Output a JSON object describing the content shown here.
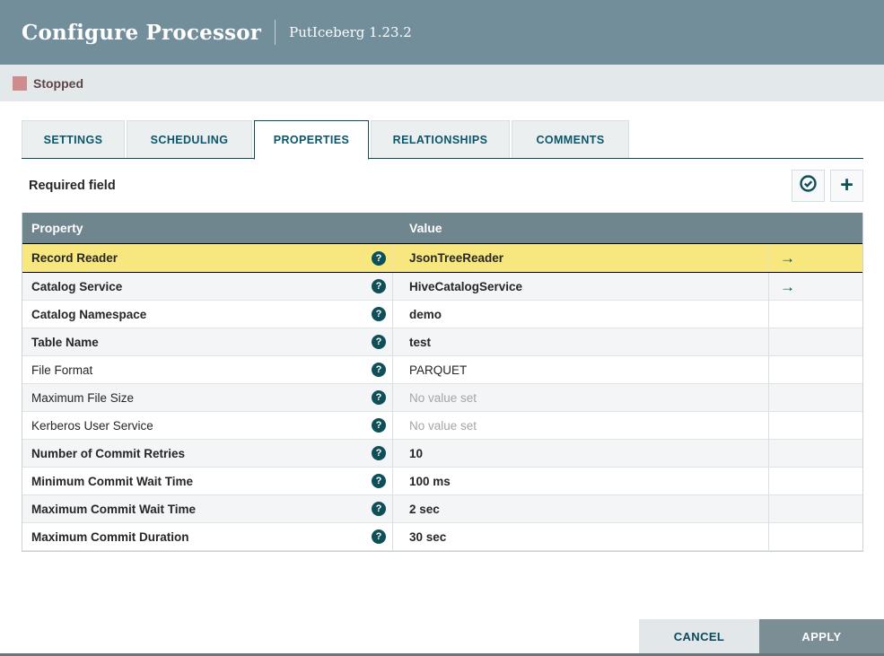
{
  "dialog": {
    "title": "Configure Processor",
    "subtitle": "PutIceberg 1.23.2"
  },
  "status": {
    "label": "Stopped",
    "color": "#CF8C8C"
  },
  "tabs": [
    {
      "label": "SETTINGS",
      "active": false
    },
    {
      "label": "SCHEDULING",
      "active": false
    },
    {
      "label": "PROPERTIES",
      "active": true
    },
    {
      "label": "RELATIONSHIPS",
      "active": false
    },
    {
      "label": "COMMENTS",
      "active": false
    }
  ],
  "properties_panel": {
    "required_field_label": "Required field",
    "verify_icon": "circle-check-icon",
    "add_icon": "plus-icon",
    "plus_glyph": "+"
  },
  "table": {
    "columns": [
      "Property",
      "Value"
    ],
    "help_glyph": "?",
    "goto_glyph": "→",
    "rows": [
      {
        "property": "Record Reader",
        "value": "JsonTreeReader",
        "required": true,
        "empty": false,
        "controller_link": true,
        "selected": true
      },
      {
        "property": "Catalog Service",
        "value": "HiveCatalogService",
        "required": true,
        "empty": false,
        "controller_link": true,
        "selected": false
      },
      {
        "property": "Catalog Namespace",
        "value": "demo",
        "required": true,
        "empty": false,
        "controller_link": false,
        "selected": false
      },
      {
        "property": "Table Name",
        "value": "test",
        "required": true,
        "empty": false,
        "controller_link": false,
        "selected": false
      },
      {
        "property": "File Format",
        "value": "PARQUET",
        "required": false,
        "empty": false,
        "controller_link": false,
        "selected": false
      },
      {
        "property": "Maximum File Size",
        "value": "No value set",
        "required": false,
        "empty": true,
        "controller_link": false,
        "selected": false
      },
      {
        "property": "Kerberos User Service",
        "value": "No value set",
        "required": false,
        "empty": true,
        "controller_link": false,
        "selected": false
      },
      {
        "property": "Number of Commit Retries",
        "value": "10",
        "required": true,
        "empty": false,
        "controller_link": false,
        "selected": false
      },
      {
        "property": "Minimum Commit Wait Time",
        "value": "100 ms",
        "required": true,
        "empty": false,
        "controller_link": false,
        "selected": false
      },
      {
        "property": "Maximum Commit Wait Time",
        "value": "2 sec",
        "required": true,
        "empty": false,
        "controller_link": false,
        "selected": false
      },
      {
        "property": "Maximum Commit Duration",
        "value": "30 sec",
        "required": true,
        "empty": false,
        "controller_link": false,
        "selected": false
      }
    ]
  },
  "footer": {
    "cancel_label": "CANCEL",
    "apply_label": "APPLY"
  },
  "colors": {
    "header_bg": "#728E9B",
    "table_header_bg": "#70868F",
    "accent_teal": "#0E4F58",
    "selected_row_bg": "#F7E77E",
    "status_bar_bg": "#E3E8EA",
    "stopped_square": "#CF8C8C",
    "apply_button_bg": "#7B8E96"
  }
}
